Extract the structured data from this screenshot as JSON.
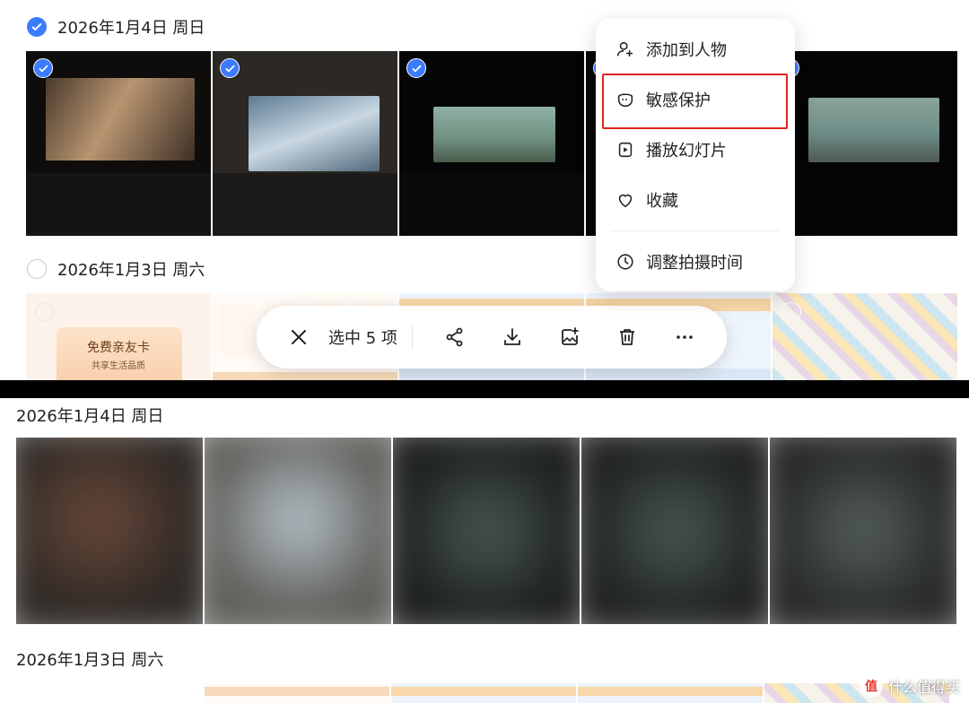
{
  "top_panel": {
    "group1": {
      "date_label": "2026年1月4日 周日",
      "selected": true
    },
    "group2": {
      "date_label": "2026年1月3日 周六",
      "selected": false
    },
    "promo_card": {
      "title": "免费亲友卡",
      "subtitle": "共享生活品质"
    }
  },
  "toolbar": {
    "selection_label": "选中 5 项",
    "icons": [
      "close-icon",
      "share-icon",
      "download-icon",
      "add-to-album-icon",
      "delete-icon",
      "more-icon"
    ]
  },
  "context_menu": {
    "items": [
      {
        "label": "添加到人物",
        "icon": "person-add-icon"
      },
      {
        "label": "敏感保护",
        "icon": "privacy-mask-icon",
        "highlighted": true
      },
      {
        "label": "播放幻灯片",
        "icon": "slideshow-icon"
      },
      {
        "label": "收藏",
        "icon": "heart-icon"
      },
      {
        "label": "调整拍摄时间",
        "icon": "clock-icon"
      }
    ]
  },
  "bottom_panel": {
    "group1": {
      "date_label": "2026年1月4日 周日"
    },
    "group2": {
      "date_label": "2026年1月3日 周六"
    }
  },
  "watermark": {
    "text": "什么值得买"
  },
  "colors": {
    "accent": "#3b7bff",
    "highlight_border": "#e0221f",
    "text": "#222222"
  }
}
